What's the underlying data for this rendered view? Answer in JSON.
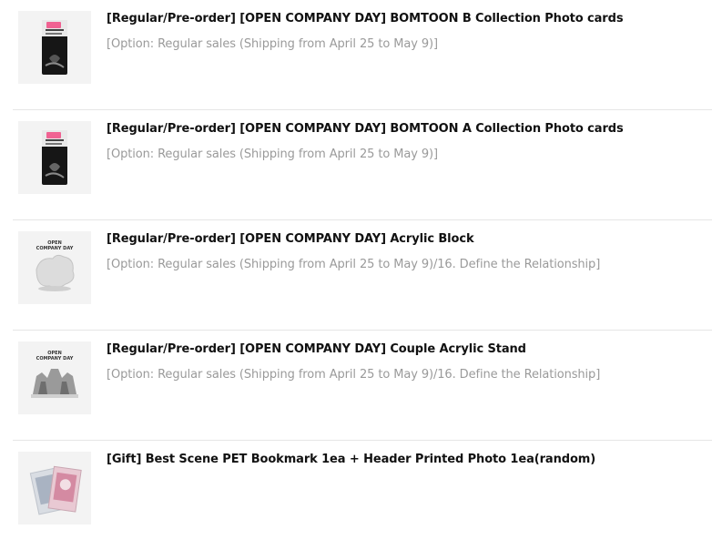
{
  "order_items": [
    {
      "title": "[Regular/Pre-order] [OPEN COMPANY DAY] BOMTOON B Collection Photo cards",
      "option": "[Option: Regular sales (Shipping from April 25 to May 9)]",
      "thumbnail": "photocard-pack-image"
    },
    {
      "title": "[Regular/Pre-order] [OPEN COMPANY DAY] BOMTOON A Collection Photo cards",
      "option": "[Option: Regular sales (Shipping from April 25 to May 9)]",
      "thumbnail": "photocard-pack-image"
    },
    {
      "title": "[Regular/Pre-order] [OPEN COMPANY DAY] Acrylic Block",
      "option": "[Option: Regular sales (Shipping from April 25 to May 9)/16. Define the Relationship]",
      "thumbnail": "acrylic-block-image",
      "thumb_text": [
        "OPEN",
        "COMPANY DAY"
      ]
    },
    {
      "title": "[Regular/Pre-order] [OPEN COMPANY DAY] Couple Acrylic Stand",
      "option": "[Option: Regular sales (Shipping from April 25 to May 9)/16. Define the Relationship]",
      "thumbnail": "acrylic-stand-image",
      "thumb_text": [
        "OPEN",
        "COMPANY DAY"
      ]
    },
    {
      "title": "[Gift] Best Scene PET Bookmark 1ea + Header Printed Photo 1ea(random)",
      "option": "",
      "thumbnail": "bookmark-photo-image"
    }
  ]
}
